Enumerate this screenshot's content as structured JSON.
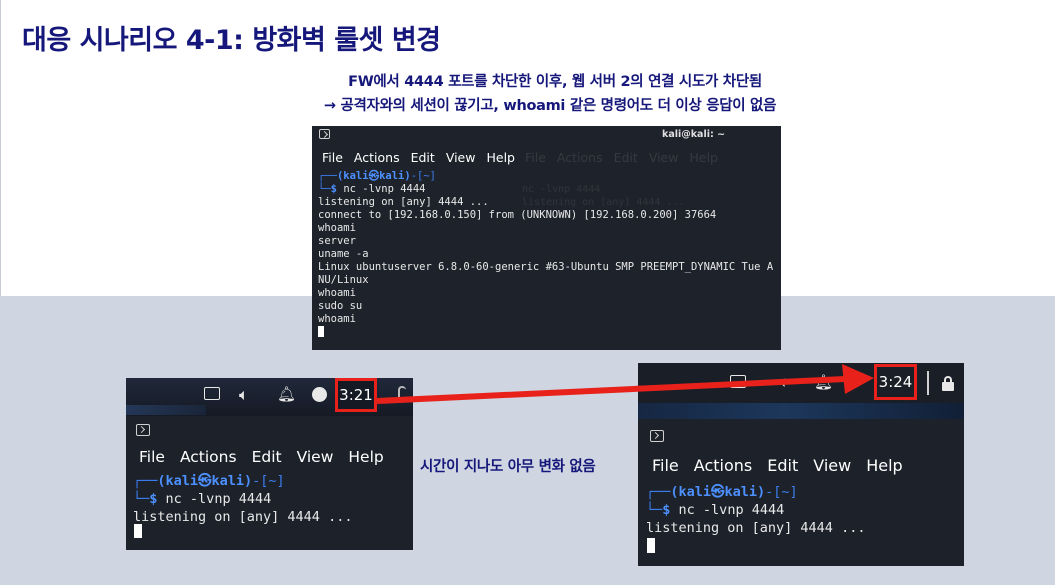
{
  "slide": {
    "title": "대응 시나리오 4-1: 방화벽 룰셋 변경",
    "subtitle_line1": "FW에서 4444 포트를 차단한 이후, 웹 서버 2의 연결 시도가 차단됨",
    "subtitle_line2": "→ 공격자와의 세션이 끊기고, whoami 같은 명령어도 더 이상 응답이 없음",
    "middle_note": "시간이 지나도 아무 변화 없음"
  },
  "main_terminal": {
    "window_title": "kali@kali: ~",
    "menu": [
      "File",
      "Actions",
      "Edit",
      "View",
      "Help"
    ],
    "prompt_user": "(kali㉿kali)",
    "prompt_dir": "-[~]",
    "command": "nc -lvnp 4444",
    "output": [
      "listening on [any] 4444 ...",
      "connect to [192.168.0.150] from (UNKNOWN) [192.168.0.200] 37664",
      "whoami",
      "server",
      "uname -a",
      "Linux ubuntuserver 6.8.0-60-generic #63-Ubuntu SMP PREEMPT_DYNAMIC Tue A",
      "NU/Linux",
      "whoami",
      "sudo su",
      "whoami"
    ]
  },
  "left_terminal": {
    "clock": "3:21",
    "menu": [
      "File",
      "Actions",
      "Edit",
      "View",
      "Help"
    ],
    "prompt_user": "(kali㉿kali)",
    "prompt_dir": "-[~]",
    "command": "nc -lvnp 4444",
    "output": [
      "listening on [any] 4444 ..."
    ]
  },
  "right_terminal": {
    "clock": "3:24",
    "menu": [
      "File",
      "Actions",
      "Edit",
      "View",
      "Help"
    ],
    "prompt_user": "(kali㉿kali)",
    "prompt_dir": "-[~]",
    "command": "nc -lvnp 4444",
    "output": [
      "listening on [any] 4444 ..."
    ]
  },
  "colors": {
    "title": "#15177a",
    "highlight": "#e8221b",
    "prompt": "#3c7ff0"
  }
}
